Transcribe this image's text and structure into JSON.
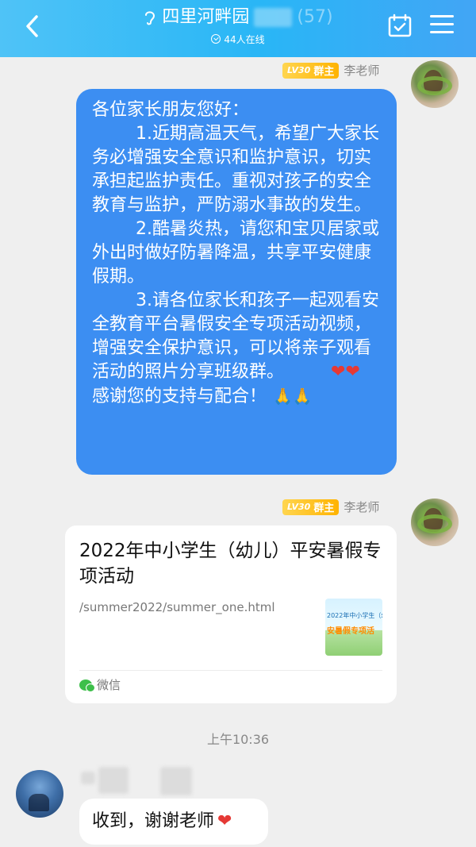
{
  "header": {
    "title": "四里河畔园",
    "member_count": "(57)",
    "online_text": "44人在线",
    "icons": {
      "back": "chevron-left-icon",
      "voice": "ear-icon",
      "calendar": "calendar-check-icon",
      "menu": "menu-icon"
    }
  },
  "messages": [
    {
      "badge_level": "LV30",
      "badge_role": "群主",
      "sender": "李老师",
      "paragraphs": [
        "各位家长朋友您好：",
        "1.近期高温天气，希望广大家长务必增强安全意识和监护意识，切实承担起监护责任。重视对孩子的安全教育与监护，严防溺水事故的发生。",
        "2.酷暑炎热，请您和宝贝居家或外出时做好防暑降温，共享平安健康假期。",
        "3.请各位家长和孩子一起观看安全教育平台暑假安全专项活动视频，增强安全保护意识，可以将亲子观看活动的照片分享班级群。",
        "感谢您的支持与配合！"
      ],
      "emoji_hearts": "❤❤",
      "emoji_hands": "🙏🙏"
    },
    {
      "badge_level": "LV30",
      "badge_role": "群主",
      "sender": "李老师",
      "card": {
        "title": "2022年中小学生（幼儿）平安暑假专项活动",
        "url": "/summer2022/summer_one.html",
        "thumb_line1": "2022年中小学生（幼",
        "thumb_line2": "安暑假专项活",
        "source": "微信"
      }
    },
    {
      "timestamp": "上午10:36"
    },
    {
      "text": "收到，谢谢老师",
      "emoji": "❤"
    }
  ],
  "colors": {
    "header_start": "#4fc3f7",
    "header_end": "#42a5f5",
    "bubble_blue": "#3c8ef2",
    "badge": "#ffb300"
  }
}
